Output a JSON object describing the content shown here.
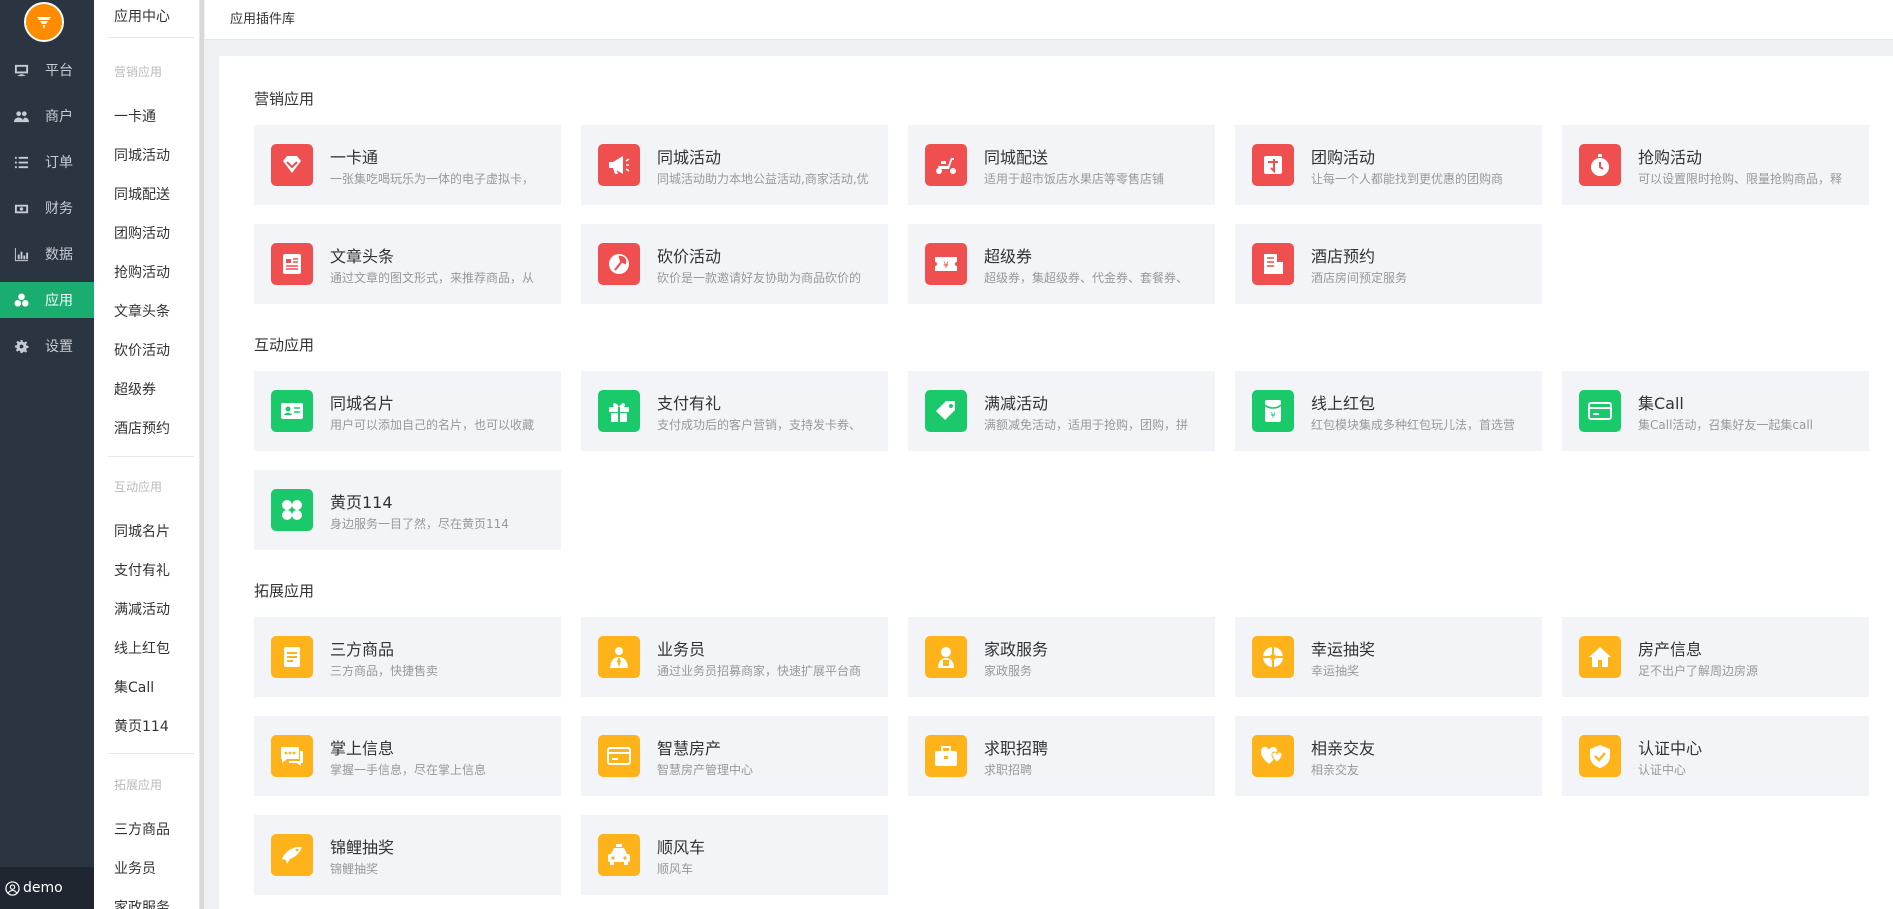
{
  "rail": {
    "items": [
      {
        "label": "平台",
        "icon": "monitor-icon"
      },
      {
        "label": "商户",
        "icon": "users-icon"
      },
      {
        "label": "订单",
        "icon": "list-icon"
      },
      {
        "label": "财务",
        "icon": "money-icon"
      },
      {
        "label": "数据",
        "icon": "bar-chart-icon"
      },
      {
        "label": "应用",
        "icon": "apps-icon"
      },
      {
        "label": "设置",
        "icon": "gear-icon"
      }
    ],
    "active": "应用",
    "user": "demo"
  },
  "subnav": {
    "title": "应用中心",
    "groups": [
      {
        "label": "营销应用",
        "items": [
          "一卡通",
          "同城活动",
          "同城配送",
          "团购活动",
          "抢购活动",
          "文章头条",
          "砍价活动",
          "超级券",
          "酒店预约"
        ]
      },
      {
        "label": "互动应用",
        "items": [
          "同城名片",
          "支付有礼",
          "满减活动",
          "线上红包",
          "集Call",
          "黄页114"
        ]
      },
      {
        "label": "拓展应用",
        "items": [
          "三方商品",
          "业务员",
          "家政服务"
        ]
      }
    ]
  },
  "breadcrumb": "应用插件库",
  "sections": [
    {
      "title": "营销应用",
      "color": "#ef4f4f",
      "cards": [
        {
          "title": "一卡通",
          "desc": "一张集吃喝玩乐为一体的电子虚拟卡，",
          "icon": "diamond-icon"
        },
        {
          "title": "同城活动",
          "desc": "同城活动助力本地公益活动,商家活动,优",
          "icon": "megaphone-icon"
        },
        {
          "title": "同城配送",
          "desc": "适用于超市饭店水果店等零售店铺",
          "icon": "scooter-icon"
        },
        {
          "title": "团购活动",
          "desc": "让每一个人都能找到更优惠的团购商",
          "icon": "group-buy-icon"
        },
        {
          "title": "抢购活动",
          "desc": "可以设置限时抢购、限量抢购商品，释",
          "icon": "stopwatch-icon"
        },
        {
          "title": "文章头条",
          "desc": "通过文章的图文形式，来推荐商品，从",
          "icon": "article-icon"
        },
        {
          "title": "砍价活动",
          "desc": "砍价是一款邀请好友协助为商品砍价的",
          "icon": "axe-icon"
        },
        {
          "title": "超级券",
          "desc": "超级券，集超级券、代金券、套餐券、",
          "icon": "coupon-icon"
        },
        {
          "title": "酒店预约",
          "desc": "酒店房间预定服务",
          "icon": "hotel-icon"
        }
      ]
    },
    {
      "title": "互动应用",
      "color": "#1ac96a",
      "cards": [
        {
          "title": "同城名片",
          "desc": "用户可以添加自己的名片，也可以收藏",
          "icon": "id-card-icon"
        },
        {
          "title": "支付有礼",
          "desc": "支付成功后的客户营销，支持发卡券、",
          "icon": "gift-icon"
        },
        {
          "title": "满减活动",
          "desc": "满额减免活动，适用于抢购，团购，拼",
          "icon": "tag-icon"
        },
        {
          "title": "线上红包",
          "desc": "红包模块集成多种红包玩儿法，首选营",
          "icon": "red-packet-icon"
        },
        {
          "title": "集Call",
          "desc": "集Call活动，召集好友一起集call",
          "icon": "card-icon"
        },
        {
          "title": "黄页114",
          "desc": "身边服务一目了然，尽在黄页114",
          "icon": "clover-icon"
        }
      ]
    },
    {
      "title": "拓展应用",
      "color": "#ffb31a",
      "cards": [
        {
          "title": "三方商品",
          "desc": "三方商品，快捷售卖",
          "icon": "document-icon"
        },
        {
          "title": "业务员",
          "desc": "通过业务员招募商家，快速扩展平台商",
          "icon": "salesman-icon"
        },
        {
          "title": "家政服务",
          "desc": "家政服务",
          "icon": "housekeeper-icon"
        },
        {
          "title": "幸运抽奖",
          "desc": "幸运抽奖",
          "icon": "lucky-wheel-icon"
        },
        {
          "title": "房产信息",
          "desc": "足不出户了解周边房源",
          "icon": "house-icon"
        },
        {
          "title": "掌上信息",
          "desc": "掌握一手信息，尽在掌上信息",
          "icon": "chat-icon"
        },
        {
          "title": "智慧房产",
          "desc": "智慧房产管理中心",
          "icon": "smart-estate-icon"
        },
        {
          "title": "求职招聘",
          "desc": "求职招聘",
          "icon": "briefcase-icon"
        },
        {
          "title": "相亲交友",
          "desc": "相亲交友",
          "icon": "hearts-icon"
        },
        {
          "title": "认证中心",
          "desc": "认证中心",
          "icon": "shield-check-icon"
        },
        {
          "title": "锦鲤抽奖",
          "desc": "锦鲤抽奖",
          "icon": "koi-icon"
        },
        {
          "title": "顺风车",
          "desc": "顺风车",
          "icon": "taxi-icon"
        }
      ]
    }
  ]
}
